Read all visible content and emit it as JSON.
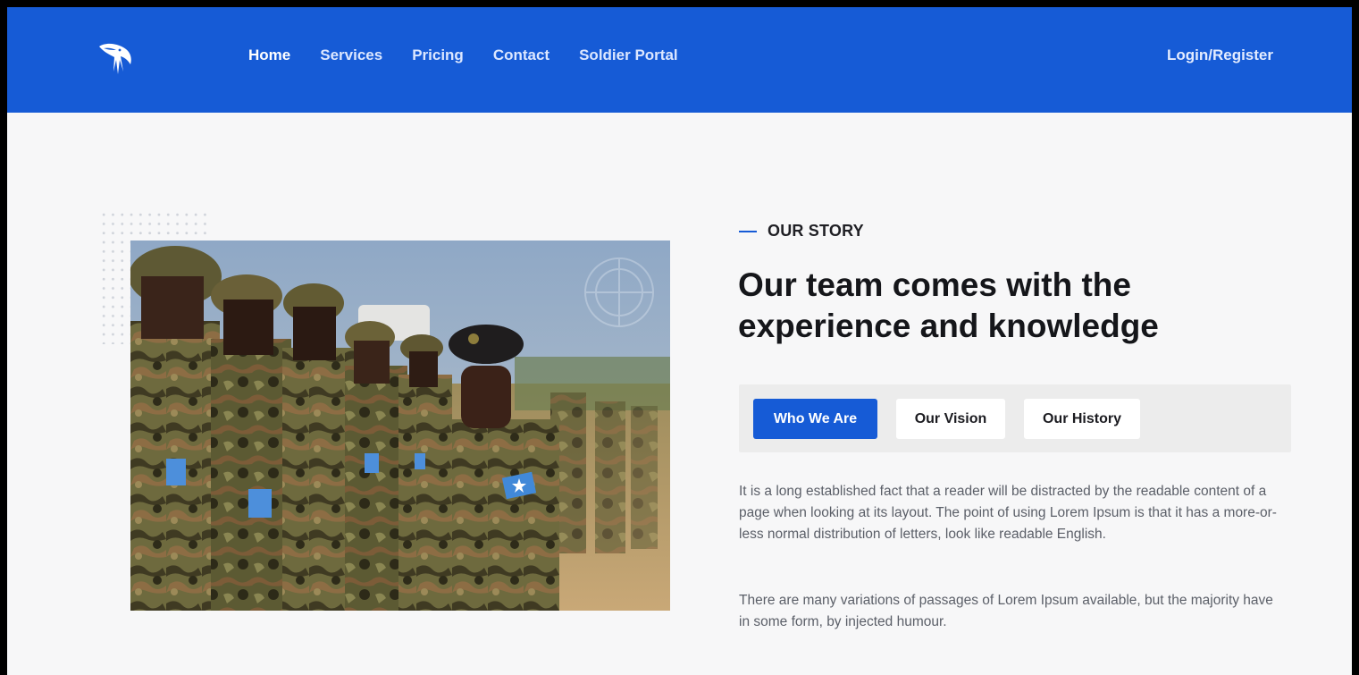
{
  "nav": {
    "logo_icon": "eagle-icon",
    "links": [
      {
        "label": "Home",
        "active": true
      },
      {
        "label": "Services",
        "active": false
      },
      {
        "label": "Pricing",
        "active": false
      },
      {
        "label": "Contact",
        "active": false
      },
      {
        "label": "Soldier Portal",
        "active": false
      }
    ],
    "login_label": "Login/Register"
  },
  "story": {
    "eyebrow": "OUR STORY",
    "heading": "Our team comes with the experience and knowledge",
    "tabs": [
      {
        "label": "Who We Are",
        "active": true
      },
      {
        "label": "Our Vision",
        "active": false
      },
      {
        "label": "Our History",
        "active": false
      }
    ],
    "paragraph_1": "It is a long established fact that a reader will be distracted by the readable content of a page when looking at its layout. The point of using Lorem Ipsum is that it has a more-or-less normal distribution of letters, look like readable English.",
    "paragraph_2": "There are many variations of passages of Lorem Ipsum available, but the majority have in some form, by injected humour."
  },
  "colors": {
    "brand_blue": "#165bd6",
    "page_bg": "#f7f7f8",
    "heading_text": "#15161a",
    "body_text": "#5b5f68"
  }
}
